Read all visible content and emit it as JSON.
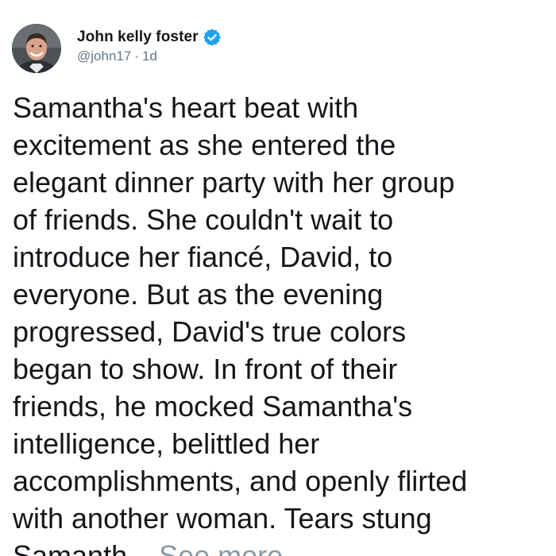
{
  "tweet": {
    "author": {
      "display_name": "John kelly foster",
      "handle": "@john17",
      "separator": "·",
      "timestamp": "1d",
      "verified": true
    },
    "body": "Samantha's heart beat with\nexcitement as she entered the\nelegant dinner party with her group\nof friends. She couldn't wait to\nintroduce her fiancé, David, to\neveryone. But as the evening\nprogressed, David's true colors\nbegan to show. In front of their\nfriends, he mocked Samantha's\nintelligence, belittled her\naccomplishments, and openly flirted\nwith another woman. Tears stung\nSamanth... ",
    "see_more_label": "See more"
  },
  "icons": {
    "avatar": "user-avatar",
    "verified": "verified-badge-icon"
  },
  "colors": {
    "text": "#14171a",
    "muted": "#657786",
    "see_more": "#8899a6",
    "verified": "#1da1f2"
  }
}
